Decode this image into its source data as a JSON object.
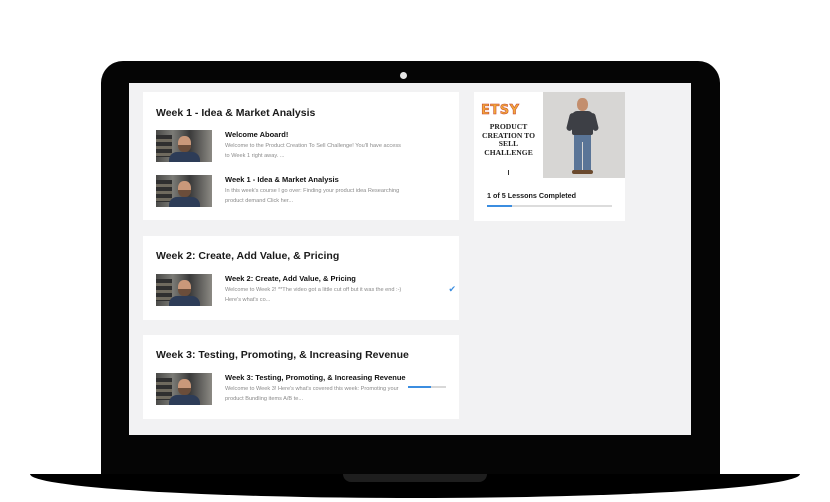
{
  "weeks": [
    {
      "title": "Week 1 - Idea & Market Analysis",
      "lessons": [
        {
          "title": "Welcome Aboard!",
          "desc": "Welcome to the Product Creation To Sell Challenge! You'll have access to Week 1 right away. ...",
          "status": "none"
        },
        {
          "title": "Week 1 - Idea & Market Analysis",
          "desc": "In this week's course I go over: Finding your product idea Researching product demand Click her...",
          "status": "none"
        }
      ]
    },
    {
      "title": "Week 2: Create, Add Value, & Pricing",
      "lessons": [
        {
          "title": "Week 2: Create, Add Value, & Pricing",
          "desc": "Welcome to Week 2! **The video got a little cut off but it was the end :-) Here's what's co...",
          "status": "completed",
          "status_icon": "check-icon"
        }
      ]
    },
    {
      "title": "Week 3: Testing, Promoting, & Increasing Revenue",
      "lessons": [
        {
          "title": "Week 3: Testing, Promoting, & Increasing Revenue",
          "desc": "Welcome to Week 3! Here's what's covered this week: Promoting your product Bundling items A/B te...",
          "status": "in-progress",
          "progress": 0.6
        }
      ]
    }
  ],
  "course": {
    "cover_brand": "ETSY",
    "cover_lines": [
      "PRODUCT",
      "CREATION TO",
      "SELL",
      "CHALLENGE"
    ],
    "completed_label": "1 of 5 Lessons Completed",
    "progress": 0.2
  },
  "colors": {
    "accent": "#3b8de0",
    "brand_orange": "#f2a93b",
    "screen_bg": "#f2f2f3",
    "frame": "#050505"
  }
}
